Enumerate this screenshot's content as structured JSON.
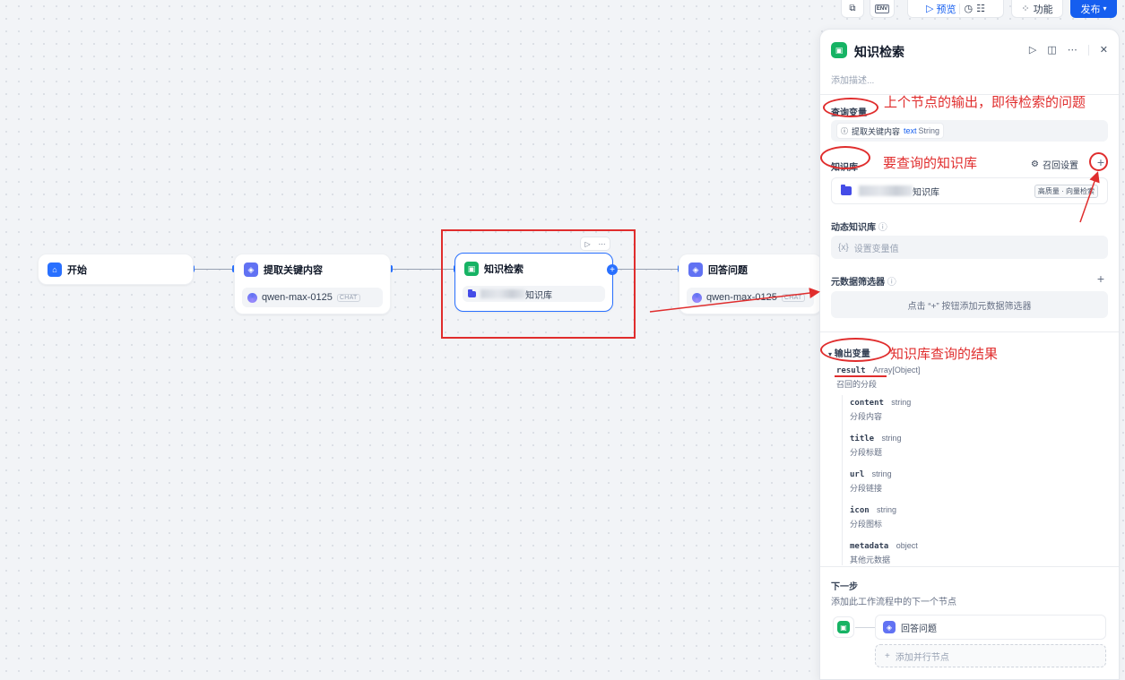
{
  "toolbar": {
    "preview_label": "预览",
    "env_label": "ENV",
    "features_label": "功能",
    "publish_label": "发布"
  },
  "nodes": [
    {
      "title": "开始"
    },
    {
      "title": "提取关键内容",
      "model": "qwen-max-0125",
      "badge": "CHAT"
    },
    {
      "title": "知识检索",
      "kb_suffix": "知识库"
    },
    {
      "title": "回答问题",
      "model": "qwen-max-0125",
      "badge": "CHAT"
    }
  ],
  "panel": {
    "title": "知识检索",
    "description_placeholder": "添加描述...",
    "query_variable": {
      "label": "查询变量",
      "chip_source": "提取关键内容",
      "chip_var": "text",
      "chip_type": "String"
    },
    "knowledge": {
      "label": "知识库",
      "recall_settings": "召回设置",
      "kb_suffix": "知识库",
      "mode_badge": "高质量 · 向量检索"
    },
    "dynamic_kb": {
      "label": "动态知识库",
      "placeholder": "设置变量值",
      "var_icon": "{x}"
    },
    "metadata_filter": {
      "label": "元数据筛选器",
      "hint": "点击 “+” 按钮添加元数据筛选器"
    },
    "output": {
      "label": "输出变量",
      "root": {
        "name": "result",
        "type": "Array[Object]",
        "desc": "召回的分段"
      },
      "children": [
        {
          "name": "content",
          "type": "string",
          "desc": "分段内容"
        },
        {
          "name": "title",
          "type": "string",
          "desc": "分段标题"
        },
        {
          "name": "url",
          "type": "string",
          "desc": "分段链接"
        },
        {
          "name": "icon",
          "type": "string",
          "desc": "分段图标"
        },
        {
          "name": "metadata",
          "type": "object",
          "desc": "其他元数据"
        }
      ]
    },
    "next_step": {
      "label": "下一步",
      "desc": "添加此工作流程中的下一个节点",
      "next_node": "回答问题",
      "add_parallel": "添加并行节点"
    }
  },
  "annotations": {
    "query_note": "上个节点的输出，即待检索的问题",
    "kb_note": "要查询的知识库",
    "result_note": "知识库查询的结果"
  },
  "colors": {
    "accent": "#155eef",
    "annotation": "#e02d2d",
    "kb_icon": "#16b364",
    "llm_icon": "#6172f3"
  }
}
